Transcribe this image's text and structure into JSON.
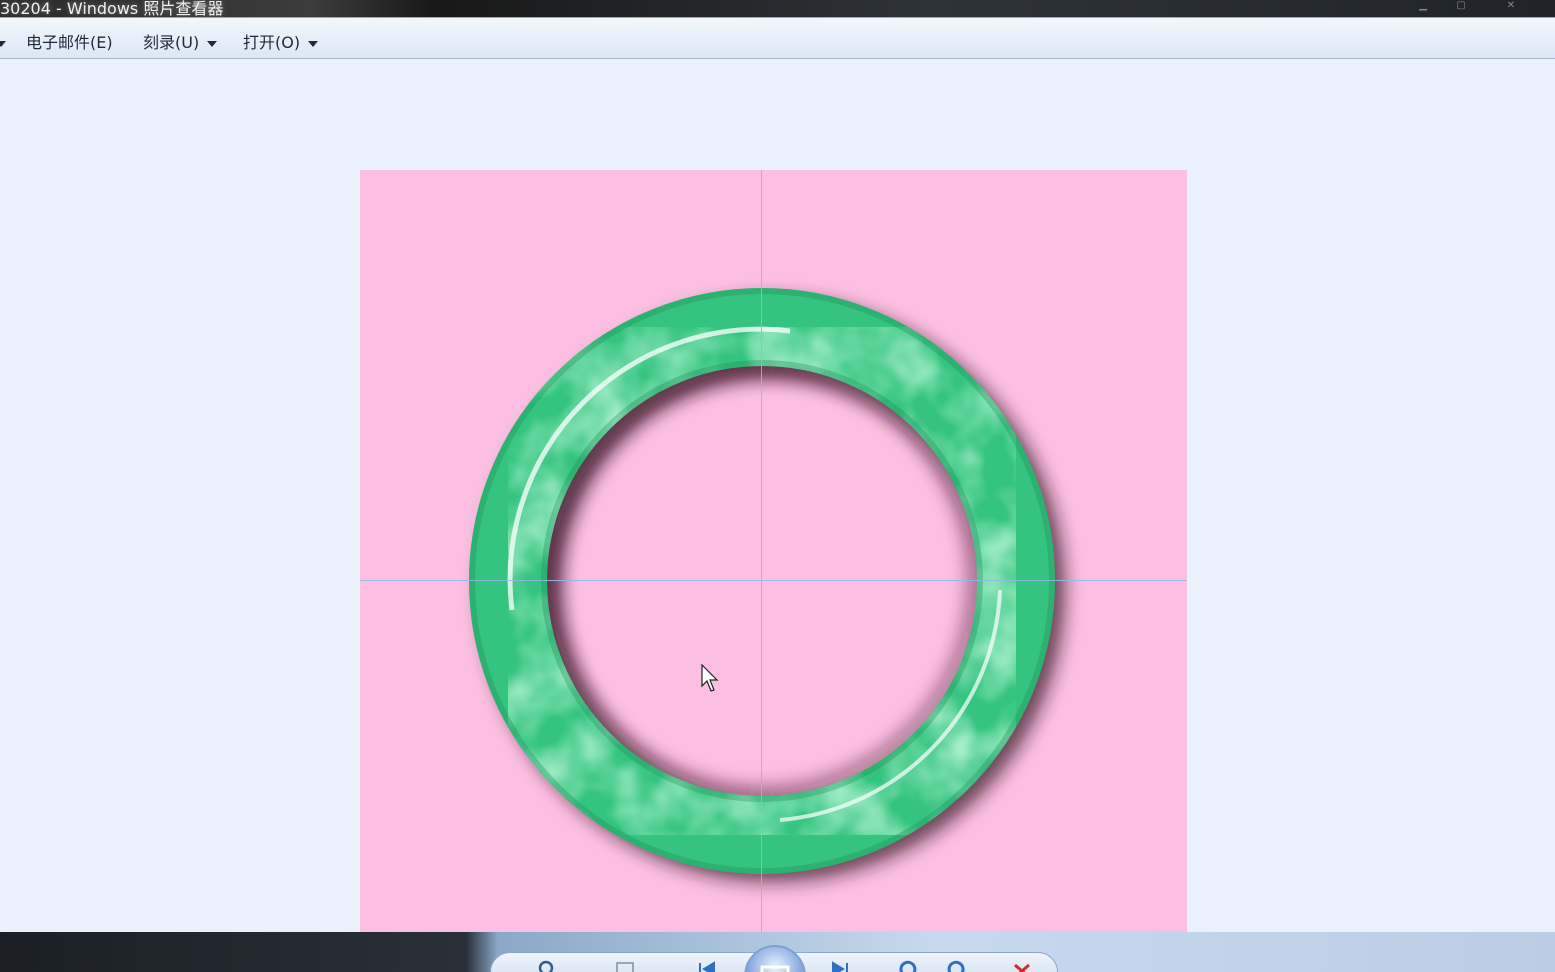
{
  "window": {
    "title": "30204 - Windows 照片查看器"
  },
  "menu": {
    "email": "电子邮件(E)",
    "burn": "刻录(U)",
    "open": "打开(O)"
  },
  "colors": {
    "photo_background": "#fcbfe3",
    "jade_green": "#2fc27d",
    "guide_line": "#8fb8e6",
    "viewer_background": "#ebf1fa"
  },
  "icons": {
    "zoom": "magnifier-icon",
    "fit": "actual-size-icon",
    "previous": "previous-icon",
    "slideshow": "slideshow-icon",
    "next": "next-icon",
    "rotate_left": "rotate-counterclockwise-icon",
    "rotate_right": "rotate-clockwise-icon",
    "delete": "delete-icon"
  }
}
